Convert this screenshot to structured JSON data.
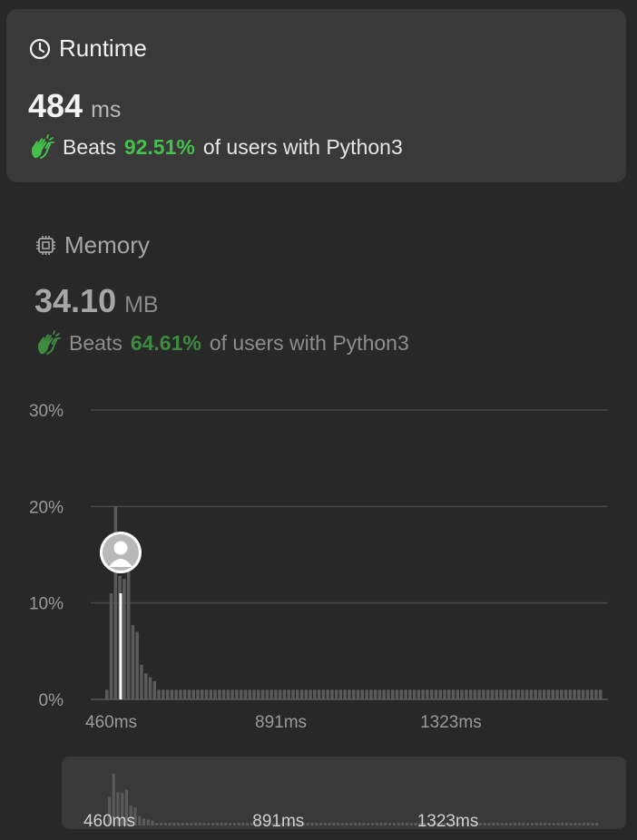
{
  "runtime": {
    "title": "Runtime",
    "icon": "clock-icon",
    "value": "484",
    "unit": "ms",
    "beats_label": "Beats",
    "percent": "92.51%",
    "suffix": "of users with Python3"
  },
  "memory": {
    "title": "Memory",
    "icon": "chip-icon",
    "value": "34.10",
    "unit": "MB",
    "beats_label": "Beats",
    "percent": "64.61%",
    "suffix": "of users with Python3"
  },
  "colors": {
    "background": "#282828",
    "card": "#393939",
    "runtime_accent": "#46c04c",
    "memory_accent": "#3d8a40",
    "bar": "#5a5a5a",
    "user_marker": "#ffffff"
  },
  "chart_data": {
    "type": "bar",
    "x_tick_labels": [
      "460ms",
      "891ms",
      "1323ms"
    ],
    "x_ticks": [
      460,
      891,
      1323
    ],
    "y_tick_labels": [
      "0%",
      "10%",
      "20%",
      "30%"
    ],
    "ylim": [
      0,
      30
    ],
    "grid": true,
    "user_value": 484,
    "user_percent": 11,
    "x": [
      449,
      460,
      471,
      482,
      493,
      504,
      515,
      526,
      537,
      548,
      559,
      570,
      581,
      592,
      603,
      614,
      625,
      636,
      647,
      658,
      669,
      680,
      691,
      702,
      713,
      724,
      735,
      746,
      757,
      768,
      779,
      790,
      801,
      812,
      823,
      834,
      845,
      856,
      867,
      878,
      889,
      900,
      911,
      922,
      933,
      944,
      955,
      966,
      977,
      988,
      999,
      1010,
      1021,
      1032,
      1043,
      1054,
      1065,
      1076,
      1087,
      1098,
      1109,
      1120,
      1131,
      1142,
      1153,
      1164,
      1175,
      1186,
      1197,
      1208,
      1219,
      1230,
      1241,
      1252,
      1263,
      1274,
      1285,
      1296,
      1307,
      1318,
      1329,
      1340,
      1351,
      1362,
      1373,
      1384,
      1395,
      1406,
      1417,
      1428,
      1439,
      1450,
      1461,
      1472,
      1483,
      1494,
      1505,
      1516,
      1527,
      1538,
      1549,
      1560,
      1571,
      1582,
      1593,
      1604,
      1615,
      1626,
      1637,
      1648,
      1659,
      1670,
      1681,
      1692,
      1703
    ],
    "values": [
      1,
      11,
      20,
      12.8,
      12.5,
      13.8,
      7.7,
      7,
      3.6,
      2.7,
      2.3,
      1.9,
      1,
      1,
      1,
      1,
      1,
      1,
      1,
      1,
      1,
      1,
      1,
      1,
      1,
      1,
      1,
      1,
      1,
      1,
      1,
      1,
      1,
      1,
      1,
      1,
      1,
      1,
      1,
      1,
      1,
      1,
      1,
      1,
      1,
      1,
      1,
      1,
      1,
      1,
      1,
      1,
      1,
      1,
      1,
      1,
      1,
      1,
      1,
      1,
      1,
      1,
      1,
      1,
      1,
      1,
      1,
      1,
      1,
      1,
      1,
      1,
      1,
      1,
      1,
      1,
      1,
      1,
      1,
      1,
      1,
      1,
      1,
      1,
      1,
      1,
      1,
      1,
      1,
      1,
      1,
      1,
      1,
      1,
      1,
      1,
      1,
      1,
      1,
      1,
      1,
      1,
      1,
      1,
      1,
      1,
      1,
      1,
      1,
      1,
      1,
      1,
      1,
      1,
      1
    ]
  }
}
